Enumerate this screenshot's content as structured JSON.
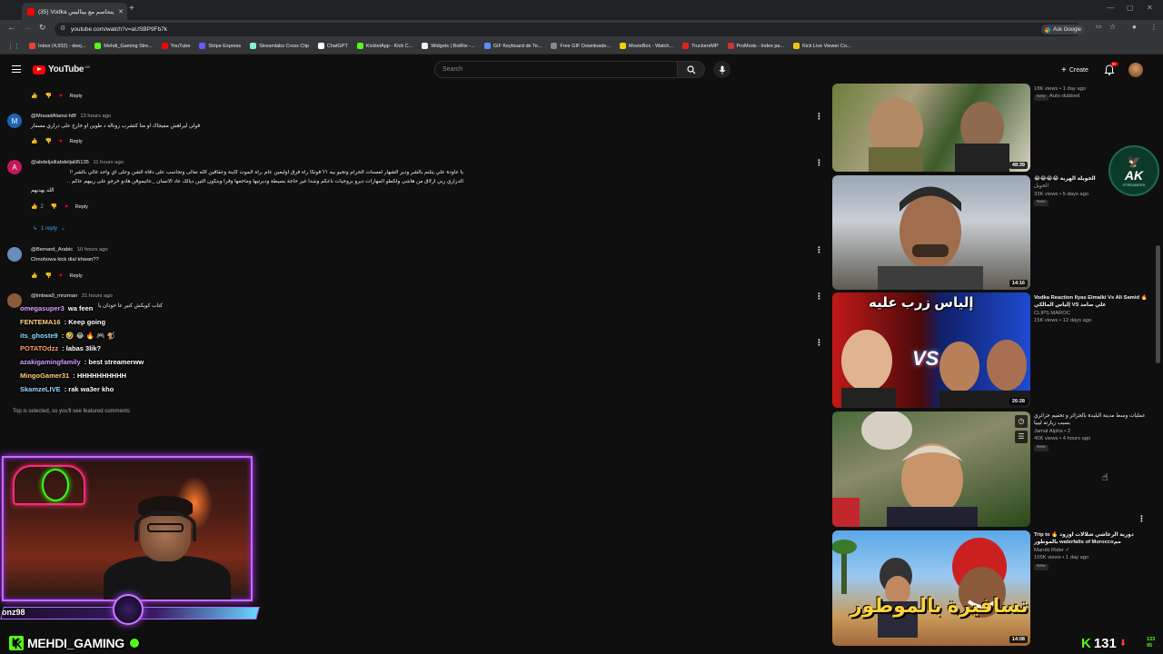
{
  "browser": {
    "tab_title": "(35) Vodka يتحاسم مع بيتاليس",
    "url": "youtube.com/watch?v=aUSBP9Fb7k",
    "ask_google": "Ask Google",
    "bookmarks": [
      {
        "label": "Inbox (4,932) - deej...",
        "color": "#ea4335"
      },
      {
        "label": "Mehdi_Gaming Stre...",
        "color": "#53fc18"
      },
      {
        "label": "YouTube",
        "color": "#ff0000"
      },
      {
        "label": "Stripe Express",
        "color": "#635bff"
      },
      {
        "label": "Streamlabs Cross Clip",
        "color": "#80f5d2"
      },
      {
        "label": "ChatGPT",
        "color": "#ffffff"
      },
      {
        "label": "KickletApp - Kick C...",
        "color": "#53fc18"
      },
      {
        "label": "Widgets | BotRix -...",
        "color": "#f1f1f1"
      },
      {
        "label": "GIF Keyboard de Te...",
        "color": "#5b8dff"
      },
      {
        "label": "Free GIF Downloade...",
        "color": "#888888"
      },
      {
        "label": "MovieBox - Watch...",
        "color": "#ffcc00"
      },
      {
        "label": "TruckersMP",
        "color": "#e2231a"
      },
      {
        "label": "ProMods - Index pa...",
        "color": "#cc3333"
      },
      {
        "label": "Kick Live Viewer Co...",
        "color": "#f4c20d"
      }
    ]
  },
  "masthead": {
    "logo_text": "YouTube",
    "logo_region": "MA",
    "search_placeholder": "Search",
    "create_label": "Create",
    "notif_count": "9+"
  },
  "comments": [
    {
      "author": "@MouadAlaoui-h8f",
      "time": "13 hours ago",
      "avatar_letter": "M",
      "avatar_color": "#1e63b5",
      "lines": [
        "قولي ليراهش مفيجاك او متا كتشرب زونالة د طوين او خارج على دراري مسفار"
      ],
      "likes": "",
      "reply_label": "Reply"
    },
    {
      "author": "@abdeljalilabdeljalil5135",
      "time": "11 hours ago",
      "avatar_letter": "A",
      "avatar_color": "#c2185b",
      "lines": [
        "يا عاودة علي يتلنم بالشر ودير الشهار لعسنات الحرام وتجيو بيه ؟؟ فوتكا راه فرق اولبعين عام ,راه الموت كاينة وعقاقين الله تعالى وتحاسب على دقاه الشن وعلى اي واحد غالي بالشر !!",
        "الدراري ربي ارلاق من هاشي ولكطو المهارات ديرو بروجيات ناعكم وشدا غير حاجة بسيطة ودبرتيها وماجعها وقرا وبنكون التين ديالك عاد الانسان _عاتيموقن هادو خرجو على ربيهم عاكم ..",
        "الله يهديهم"
      ],
      "likes": "2",
      "reply_label": "Reply"
    },
    {
      "author": "@Bernard_Arabic",
      "time": "10 hours ago",
      "avatar_letter": "",
      "avatar_color": "#6b8cba",
      "lines": [
        "Chnohowa kick dial khwan??"
      ],
      "likes": "",
      "reply_label": "Reply"
    },
    {
      "author": "@lmbwa9_mnzman",
      "time": "21 hours ago",
      "avatar_letter": "",
      "avatar_color": "#8a5a3a",
      "lines": [
        "كتاب كويكش كنير عا حودان يا"
      ],
      "likes": "",
      "reply_label": "Reply"
    }
  ],
  "replies_toggle": "1 reply",
  "top_note": "Top is selected, so you'll see featured comments",
  "chat": [
    {
      "user": "omegasuper3",
      "color": "#d9a3ff",
      "sep": " ",
      "msg": "wa feen"
    },
    {
      "user": "FENTEMA16",
      "color": "#ffd27a",
      "sep": " : ",
      "msg": "Keep going"
    },
    {
      "user": "its_ghoste9",
      "color": "#80e0ff",
      "sep": " : ",
      "msg": "🤣 😂 🔥 🎮 🐒"
    },
    {
      "user": "POTATOdzz",
      "color": "#ff9f6b",
      "sep": " : ",
      "msg": "labas 3lik?"
    },
    {
      "user": "azakigamingfamily",
      "color": "#c9a0ff",
      "sep": " : ",
      "msg": "best streamerww"
    },
    {
      "user": "MingoGamer31",
      "color": "#ffd27a",
      "sep": " : ",
      "msg": "HHHHHHHHHH"
    },
    {
      "user": "SkamzeLIVE",
      "color": "#9bd8ff",
      "sep": " : ",
      "msg": "rak wa3er kho"
    }
  ],
  "overlay": {
    "bar_text": "onz98",
    "streamer_name": "MEHDI_GAMING",
    "kick_counter": "131",
    "mini_stats_top": "133",
    "mini_stats_bottom": "95"
  },
  "recommendations": [
    {
      "title": "",
      "channel": "",
      "stats": "18K views • 1 day ago",
      "badge": "New",
      "extra": "Auto-dubbed",
      "duration": "48:39"
    },
    {
      "title": "الخويلة الهربة 😂😂😂😂",
      "channel": "الخويل",
      "stats": "33K views • 5 days ago",
      "badge": "New",
      "extra": "",
      "duration": "14:16"
    },
    {
      "title": "Vodka Reaction Ilyas Elmalki Vs Ali Samid 🔥 إلياس المالكي VS علي صامد",
      "channel": "CLIPS MAROC",
      "stats": "15K views • 12 days ago",
      "badge": "",
      "extra": "",
      "duration": "26:28"
    },
    {
      "title": "عمليات وسط مدينة البليدة بالجزائر و تخفيم جزائري بسبب زيارته ليبيا",
      "channel": "Jamal Alpha • 2",
      "stats": "40K views • 4 hours ago",
      "badge": "New",
      "extra": "",
      "duration": ""
    },
    {
      "title": "Trip to 🔥 دورية الرعاشي شلالات اوزود بالموطور waterfalls of Moroccoمم",
      "channel": "Maroki Rider ✓",
      "stats": "105K views • 1 day ago",
      "badge": "New",
      "extra": "",
      "duration": "14:08"
    }
  ],
  "thumb_texts": {
    "t3_overlay": "إلياس زرب عليه",
    "t3_vs": "VS",
    "t5_overlay": "تسافيرة بالموطور"
  },
  "ak_logo": {
    "big": "AK",
    "small": "STREAMERS"
  },
  "colors": {
    "bg": "#0f0f0f",
    "accent": "#ff0000",
    "link": "#3ea6ff",
    "kick_green": "#53fc18",
    "neon_purple": "#d067ff"
  }
}
